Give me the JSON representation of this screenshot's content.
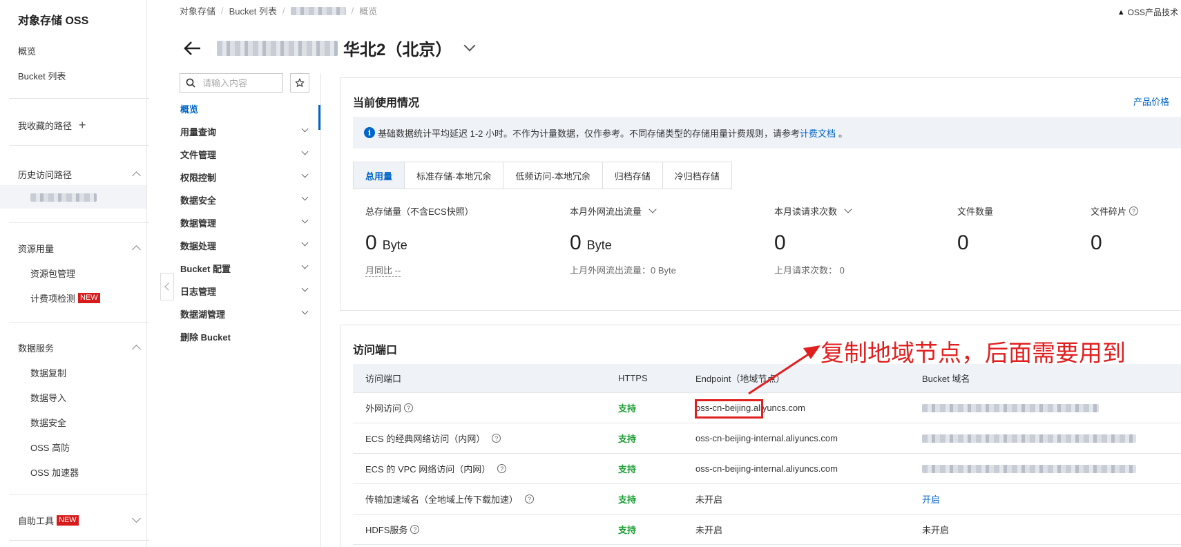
{
  "sidebar": {
    "brand": "对象存储 OSS",
    "items": [
      {
        "label": "概览"
      },
      {
        "label": "Bucket 列表"
      }
    ],
    "favorites_label": "我收藏的路径",
    "history_label": "历史访问路径",
    "resource_section": {
      "label": "资源用量",
      "items": [
        "资源包管理",
        "计费项检测"
      ]
    },
    "data_service_section": {
      "label": "数据服务",
      "items": [
        "数据复制",
        "数据导入",
        "数据安全",
        "OSS 高防",
        "OSS 加速器"
      ]
    },
    "tools_label": "自助工具",
    "new_badge": "NEW"
  },
  "breadcrumb": {
    "items": [
      "对象存储",
      "Bucket 列表"
    ],
    "current": "概览"
  },
  "top_right": {
    "label": "OSS产品技术"
  },
  "title": {
    "region": "华北2（北京）"
  },
  "nav2": {
    "search_placeholder": "请输入内容",
    "items": [
      {
        "label": "概览",
        "active": true,
        "expandable": false
      },
      {
        "label": "用量查询",
        "expandable": true
      },
      {
        "label": "文件管理",
        "expandable": true
      },
      {
        "label": "权限控制",
        "expandable": true
      },
      {
        "label": "数据安全",
        "expandable": true
      },
      {
        "label": "数据管理",
        "expandable": true
      },
      {
        "label": "数据处理",
        "expandable": true
      },
      {
        "label": "Bucket 配置",
        "expandable": true
      },
      {
        "label": "日志管理",
        "expandable": true
      },
      {
        "label": "数据湖管理",
        "expandable": true
      },
      {
        "label": "删除 Bucket",
        "expandable": false
      }
    ]
  },
  "usage": {
    "title": "当前使用情况",
    "price_link": "产品价格",
    "notice_text": "基础数据统计平均延迟 1-2 小时。不作为计量数据，仅作参考。不同存储类型的存储用量计费规则，请参考",
    "notice_link": "计费文档",
    "notice_end": "。",
    "tabs": [
      "总用量",
      "标准存储-本地冗余",
      "低频访问-本地冗余",
      "归档存储",
      "冷归档存储"
    ],
    "active_tab": 0,
    "metrics": [
      {
        "label": "总存储量（不含ECS快照）",
        "value": "0",
        "unit": "Byte",
        "sub": "月同比 --"
      },
      {
        "label": "本月外网流出流量",
        "value": "0",
        "unit": "Byte",
        "sub": "上月外网流出流量：0 Byte"
      },
      {
        "label": "本月读请求次数",
        "value": "0",
        "unit": "",
        "sub": "上月请求次数：  0"
      },
      {
        "label": "文件数量",
        "value": "0",
        "unit": "",
        "sub": ""
      },
      {
        "label": "文件碎片",
        "value": "0",
        "unit": "",
        "sub": ""
      }
    ]
  },
  "endpoints": {
    "title": "访问端口",
    "headers": [
      "访问端口",
      "HTTPS",
      "Endpoint（地域节点）",
      "Bucket 域名"
    ],
    "rows": [
      {
        "name": "外网访问",
        "https": "支持",
        "endpoint": "oss-cn-beijing.aliyuncs.com",
        "domain": ""
      },
      {
        "name": "ECS 的经典网络访问（内网）",
        "https": "支持",
        "endpoint": "oss-cn-beijing-internal.aliyuncs.com",
        "domain": ""
      },
      {
        "name": "ECS 的 VPC 网络访问（内网）",
        "https": "支持",
        "endpoint": "oss-cn-beijing-internal.aliyuncs.com",
        "domain": ""
      },
      {
        "name": "传输加速域名（全地域上传下载加速）",
        "https": "支持",
        "endpoint": "未开启",
        "domain": "开启"
      },
      {
        "name": "HDFS服务",
        "https": "支持",
        "endpoint": "未开启",
        "domain": "未开启"
      }
    ]
  },
  "annotation": {
    "text": "复制地域节点，后面需要用到",
    "color": "#e02020"
  },
  "colors": {
    "accent": "#0064c8",
    "support": "#1a9e32",
    "new_badge": "#d71a1a"
  }
}
